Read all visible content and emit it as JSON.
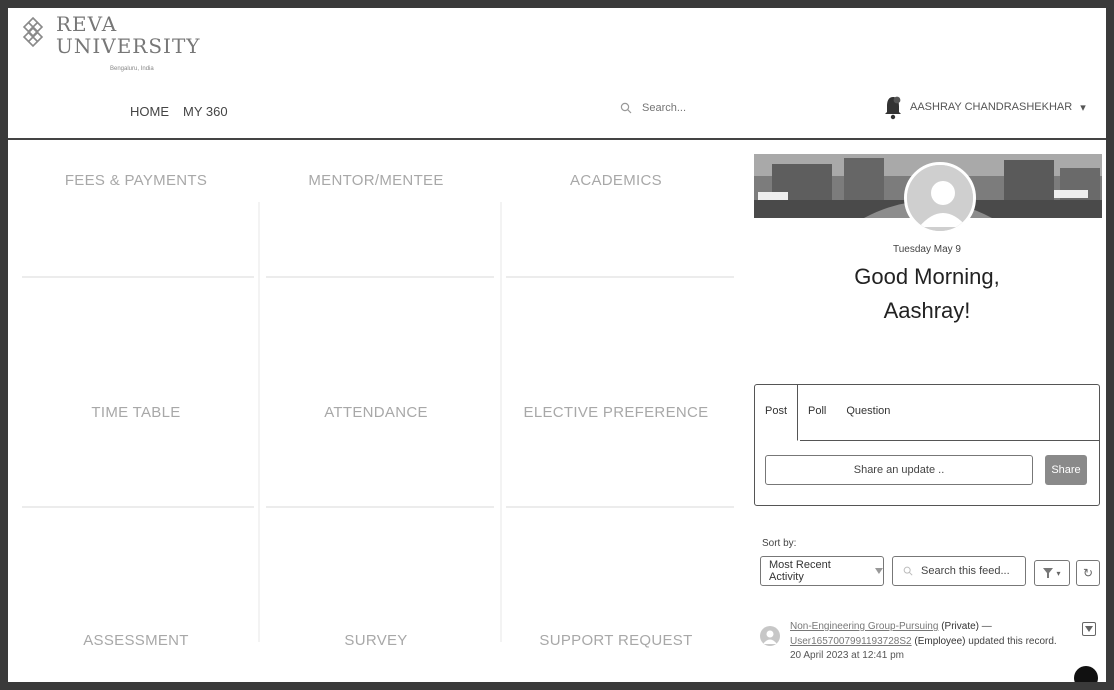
{
  "brand": {
    "line1": "REVA",
    "line2": "UNIVERSITY",
    "sub": "Bengaluru, India"
  },
  "nav": {
    "items": [
      {
        "label": "HOME"
      },
      {
        "label": "MY 360"
      }
    ]
  },
  "search": {
    "placeholder": "Search..."
  },
  "user": {
    "name": "AASHRAY CHANDRASHEKHAR",
    "caret": "▾"
  },
  "tiles": [
    {
      "label": "FEES & PAYMENTS"
    },
    {
      "label": "MENTOR/MENTEE"
    },
    {
      "label": "ACADEMICS"
    },
    {
      "label": "TIME TABLE"
    },
    {
      "label": "ATTENDANCE"
    },
    {
      "label": "ELECTIVE PREFERENCE"
    },
    {
      "label": "ASSESSMENT"
    },
    {
      "label": "SURVEY"
    },
    {
      "label": "SUPPORT REQUEST"
    }
  ],
  "profile": {
    "date": "Tuesday May 9",
    "greeting_line1": "Good Morning,",
    "greeting_line2": "Aashray!"
  },
  "publisher": {
    "tabs": [
      {
        "label": "Post"
      },
      {
        "label": "Poll"
      },
      {
        "label": "Question"
      }
    ],
    "input_placeholder": "Share an update ..",
    "share_label": "Share"
  },
  "feed": {
    "sort_label": "Sort by:",
    "sort_value": "Most Recent Activity",
    "search_placeholder": "Search this feed...",
    "filter_label": "▾",
    "refresh_label": "↻",
    "item": {
      "group": "Non-Engineering Group-Pursuing",
      "privacy": "(Private)",
      "dash": " —",
      "user": "User1657007991193728S2",
      "role": "(Employee)",
      "action": "updated this record.",
      "time": "20 April 2023 at 12:41 pm"
    }
  },
  "colors": {
    "tile_text": "#a8a8a8",
    "share_button": "#8a8a8a",
    "border": "#555555"
  }
}
